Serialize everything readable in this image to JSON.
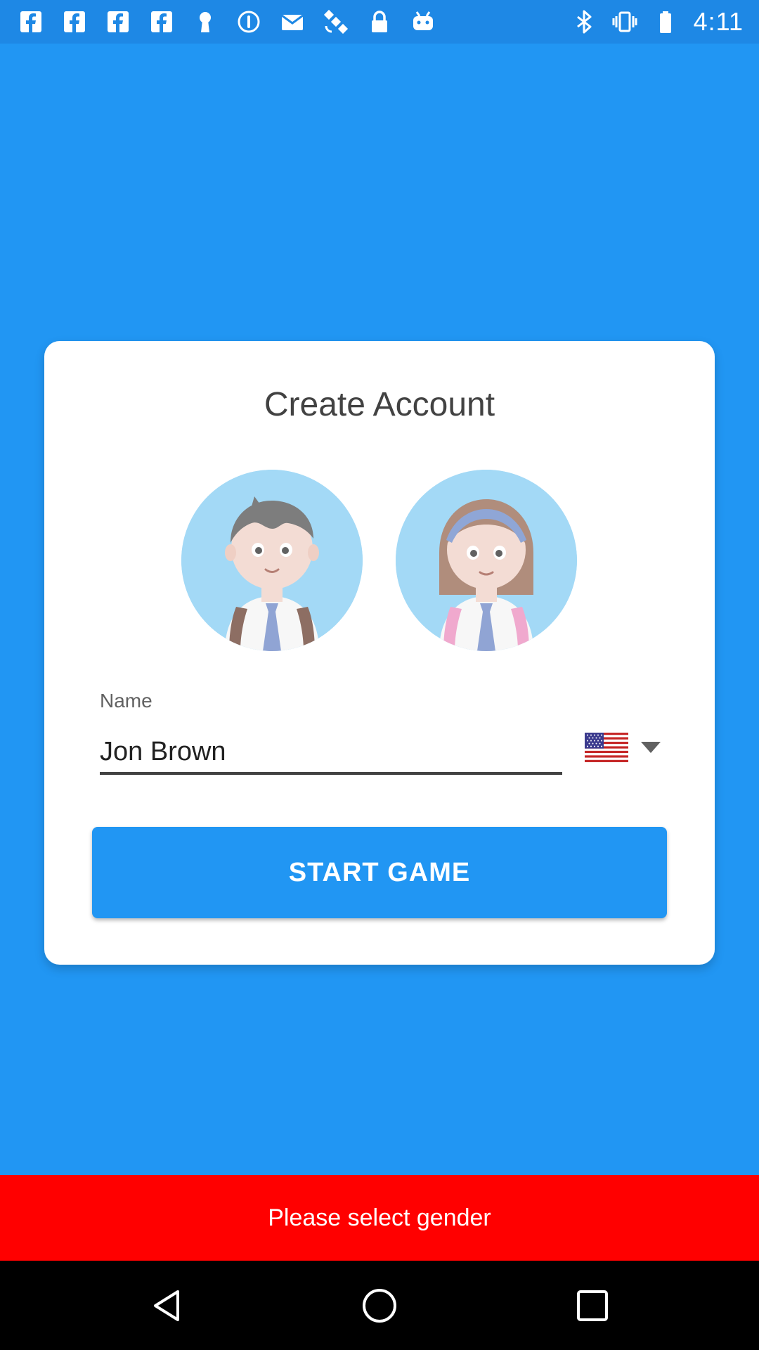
{
  "status_bar": {
    "time": "4:11",
    "left_icons": [
      "facebook-icon",
      "facebook-icon",
      "facebook-icon",
      "facebook-icon",
      "keyhole-icon",
      "info-circle-icon",
      "email-icon",
      "satellite-icon",
      "lock-icon",
      "android-icon"
    ],
    "right_icons": [
      "bluetooth-icon",
      "vibrate-icon",
      "battery-icon"
    ]
  },
  "card": {
    "title": "Create Account",
    "avatars": [
      {
        "name": "boy-avatar",
        "gender": "male"
      },
      {
        "name": "girl-avatar",
        "gender": "female"
      }
    ],
    "name_field": {
      "label": "Name",
      "value": "Jon Brown"
    },
    "country_picker": {
      "flag": "us-flag-icon"
    },
    "start_button_label": "START GAME"
  },
  "snackbar": {
    "message": "Please select gender"
  },
  "nav_bar": {
    "buttons": [
      "back-icon",
      "home-icon",
      "recents-icon"
    ]
  },
  "colors": {
    "background": "#2196F3",
    "card": "#FFFFFF",
    "button": "#2196F3",
    "snackbar": "#FF0000",
    "avatar_bg": "#A3D9F6"
  }
}
